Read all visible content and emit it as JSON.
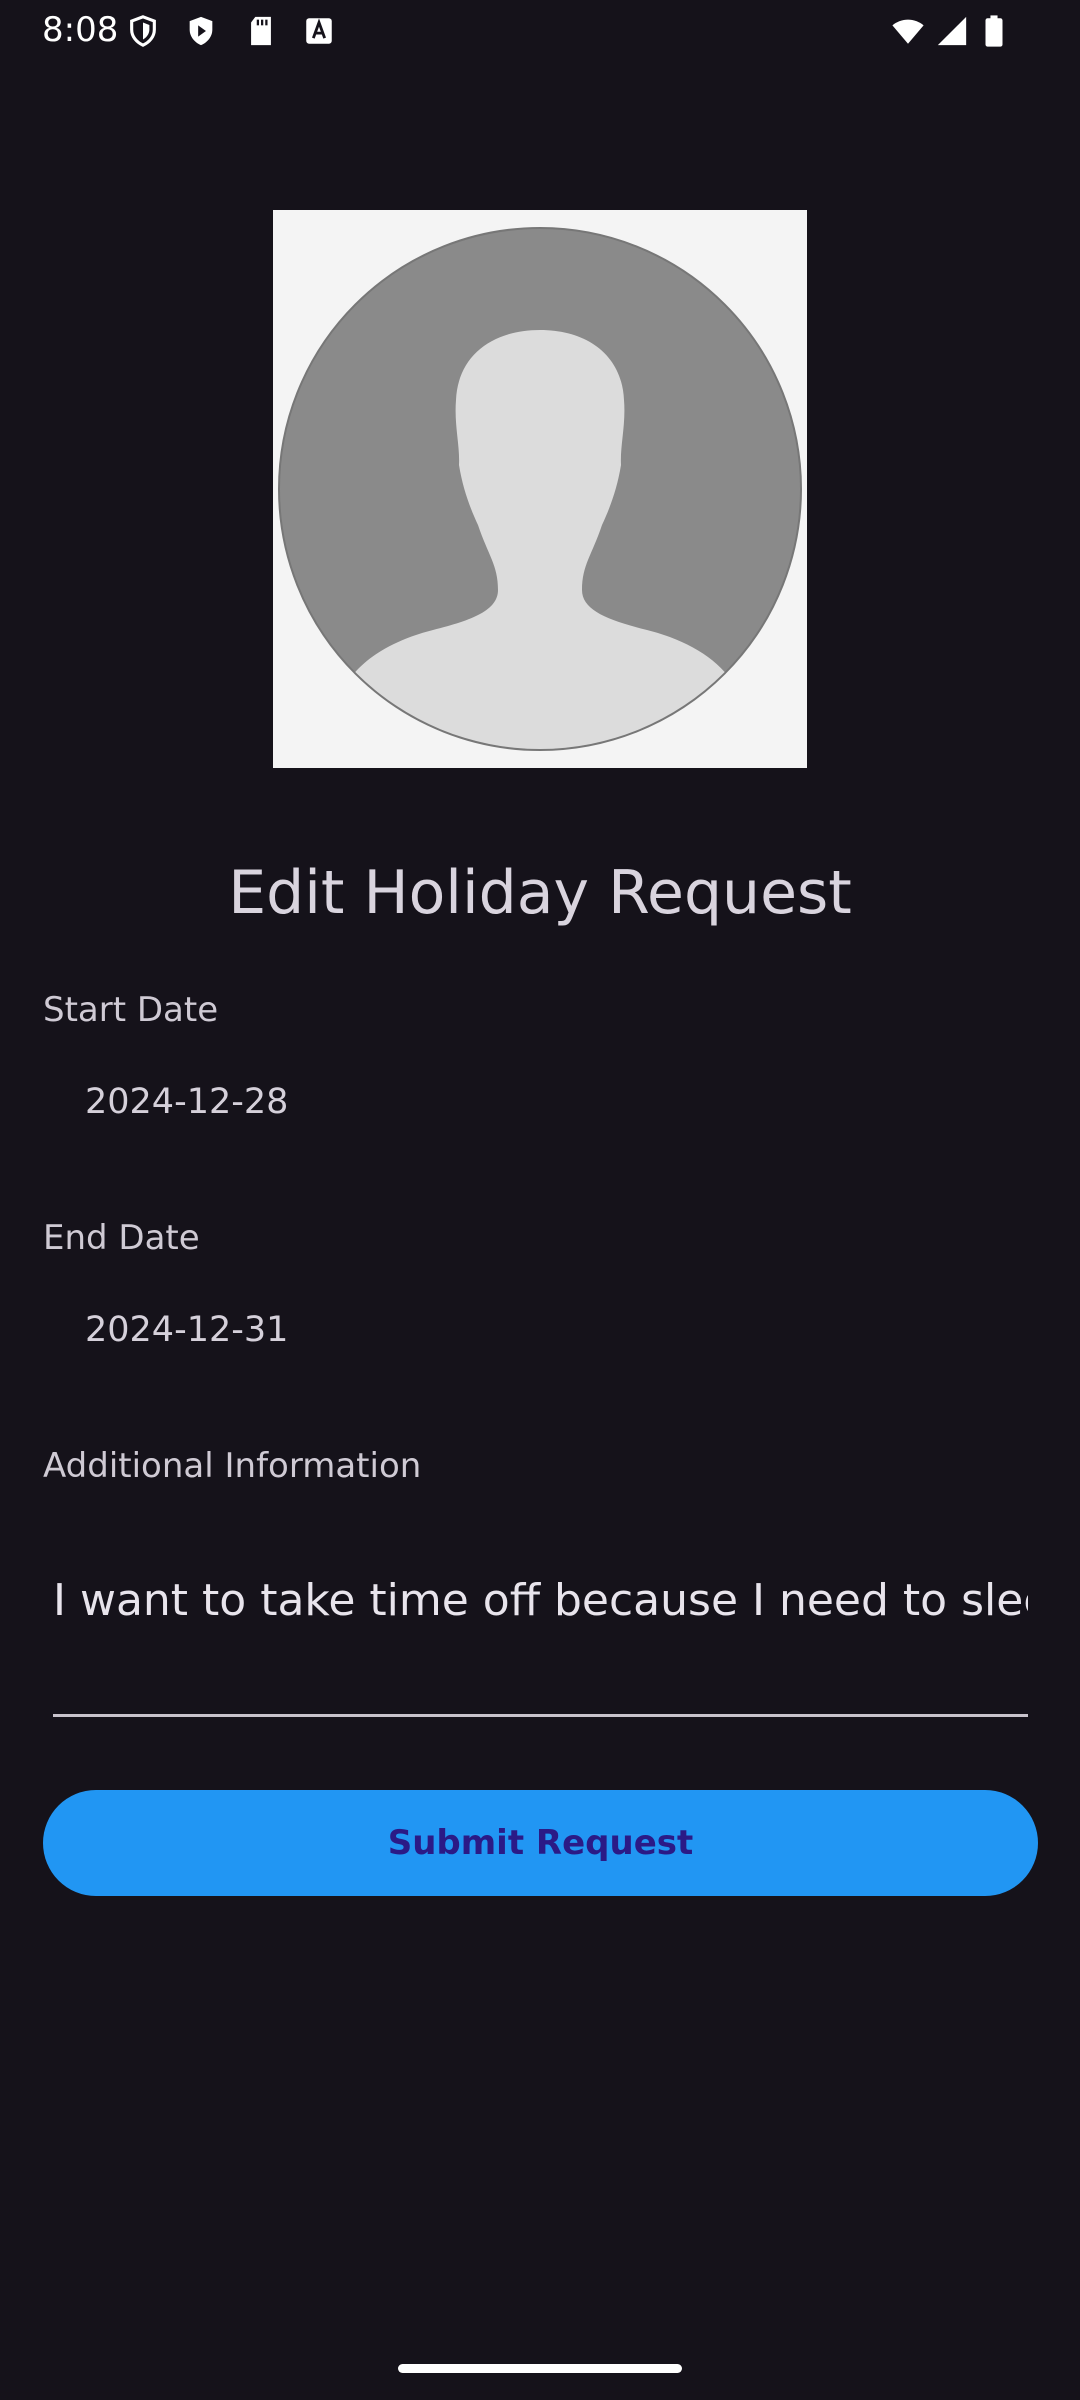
{
  "status_bar": {
    "time": "8:08",
    "left_icons": [
      "shield-icon",
      "play-protect-icon",
      "sd-card-icon",
      "keyboard-a-icon"
    ],
    "right_icons": [
      "wifi-icon",
      "cell-signal-icon",
      "battery-icon"
    ]
  },
  "avatar": {
    "icon": "default-person-avatar-icon"
  },
  "page": {
    "title": "Edit Holiday Request"
  },
  "form": {
    "start_date": {
      "label": "Start Date",
      "value": "2024-12-28"
    },
    "end_date": {
      "label": "End Date",
      "value": "2024-12-31"
    },
    "additional_info": {
      "label": "Additional Information",
      "value": "I want to take time off because I need to sleep."
    },
    "submit_label": "Submit Request"
  },
  "colors": {
    "background": "#15121a",
    "button": "#2196f3",
    "button_text": "#2b1a86"
  }
}
